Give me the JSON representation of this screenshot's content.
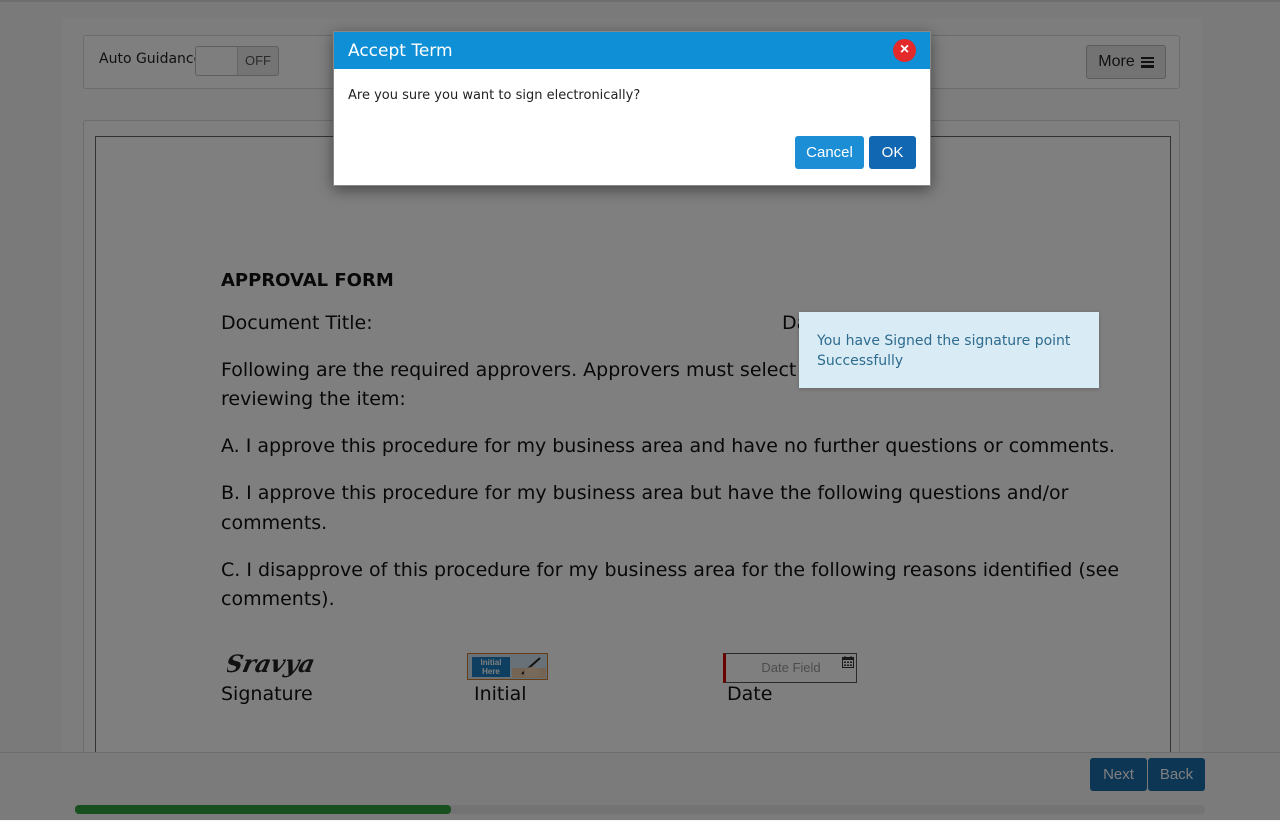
{
  "toolbar": {
    "auto_guidance_label": "Auto Guidance",
    "toggle_state": "OFF",
    "more_label": "More"
  },
  "document": {
    "title": "APPROVAL FORM",
    "doc_title_label": "Document Title:",
    "date_label_partial": "Da",
    "intro_line1": "Following are the required approvers. Approvers must select one of",
    "intro_line2": "reviewing the item:",
    "option_a": "A. I approve this procedure for my business area and have no further questions or comments.",
    "option_b_line1": "B. I approve this procedure for my business area but have the following questions and/or",
    "option_b_line2": "comments.",
    "option_c_line1": "C. I disapprove of this procedure for my business area for the following reasons identified (see",
    "option_c_line2": "comments).",
    "signature_name": "Sravya",
    "signature_label": "Signature",
    "initial_tag": "Initial Here",
    "initial_label": "Initial",
    "date_field_placeholder": "Date Field",
    "date_label": "Date"
  },
  "footer": {
    "next_label": "Next",
    "back_label": "Back",
    "progress": 0.333
  },
  "toast": {
    "message": "You have Signed the signature point Successfully"
  },
  "modal": {
    "title": "Accept Term",
    "close_glyph": "×",
    "body": "Are you sure you want to sign electronically?",
    "cancel_label": "Cancel",
    "ok_label": "OK"
  },
  "colors": {
    "modal_header": "#0e8fd6",
    "close_button": "#e32929",
    "primary_button": "#1167b1",
    "progress_fill": "#2e9e3e",
    "toast_bg": "#d9ecf5"
  }
}
